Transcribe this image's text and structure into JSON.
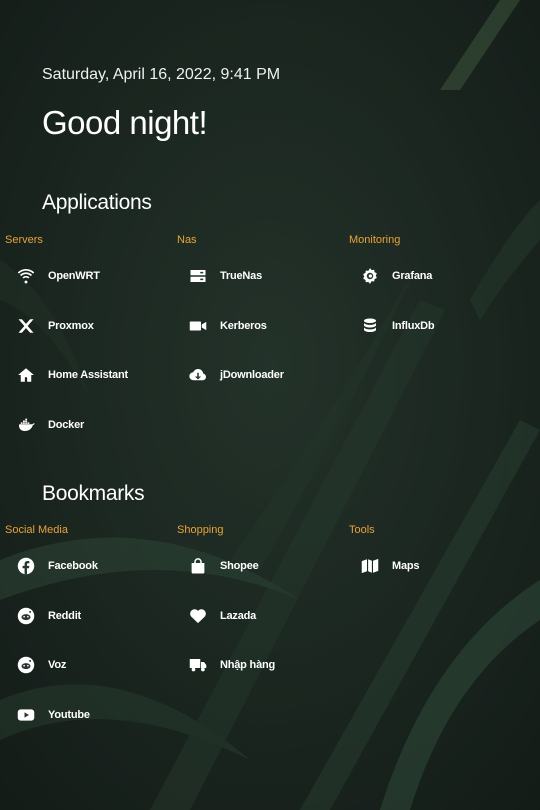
{
  "datetime": "Saturday, April 16, 2022, 9:41 PM",
  "greeting": "Good night!",
  "applications": {
    "title": "Applications",
    "groups": [
      {
        "name": "Servers",
        "items": [
          {
            "label": "OpenWRT",
            "icon": "wifi-icon"
          },
          {
            "label": "Proxmox",
            "icon": "proxmox-icon"
          },
          {
            "label": "Home Assistant",
            "icon": "home-icon"
          },
          {
            "label": "Docker",
            "icon": "docker-icon"
          }
        ]
      },
      {
        "name": "Nas",
        "items": [
          {
            "label": "TrueNas",
            "icon": "server-icon"
          },
          {
            "label": "Kerberos",
            "icon": "video-camera-icon"
          },
          {
            "label": "jDownloader",
            "icon": "cloud-download-icon"
          }
        ]
      },
      {
        "name": "Monitoring",
        "items": [
          {
            "label": "Grafana",
            "icon": "grafana-icon"
          },
          {
            "label": "InfluxDb",
            "icon": "database-icon"
          }
        ]
      }
    ]
  },
  "bookmarks": {
    "title": "Bookmarks",
    "groups": [
      {
        "name": "Social Media",
        "items": [
          {
            "label": "Facebook",
            "icon": "facebook-icon"
          },
          {
            "label": "Reddit",
            "icon": "reddit-icon"
          },
          {
            "label": "Voz",
            "icon": "reddit-icon"
          },
          {
            "label": "Youtube",
            "icon": "youtube-icon"
          }
        ]
      },
      {
        "name": "Shopping",
        "items": [
          {
            "label": "Shopee",
            "icon": "shopping-bag-icon"
          },
          {
            "label": "Lazada",
            "icon": "heart-icon"
          },
          {
            "label": "Nhập hàng",
            "icon": "truck-icon"
          }
        ]
      },
      {
        "name": "Tools",
        "items": [
          {
            "label": "Maps",
            "icon": "map-icon"
          }
        ]
      }
    ]
  },
  "colors": {
    "accent": "#e8a23a",
    "text": "#ffffff",
    "background": "#1e2a24"
  }
}
